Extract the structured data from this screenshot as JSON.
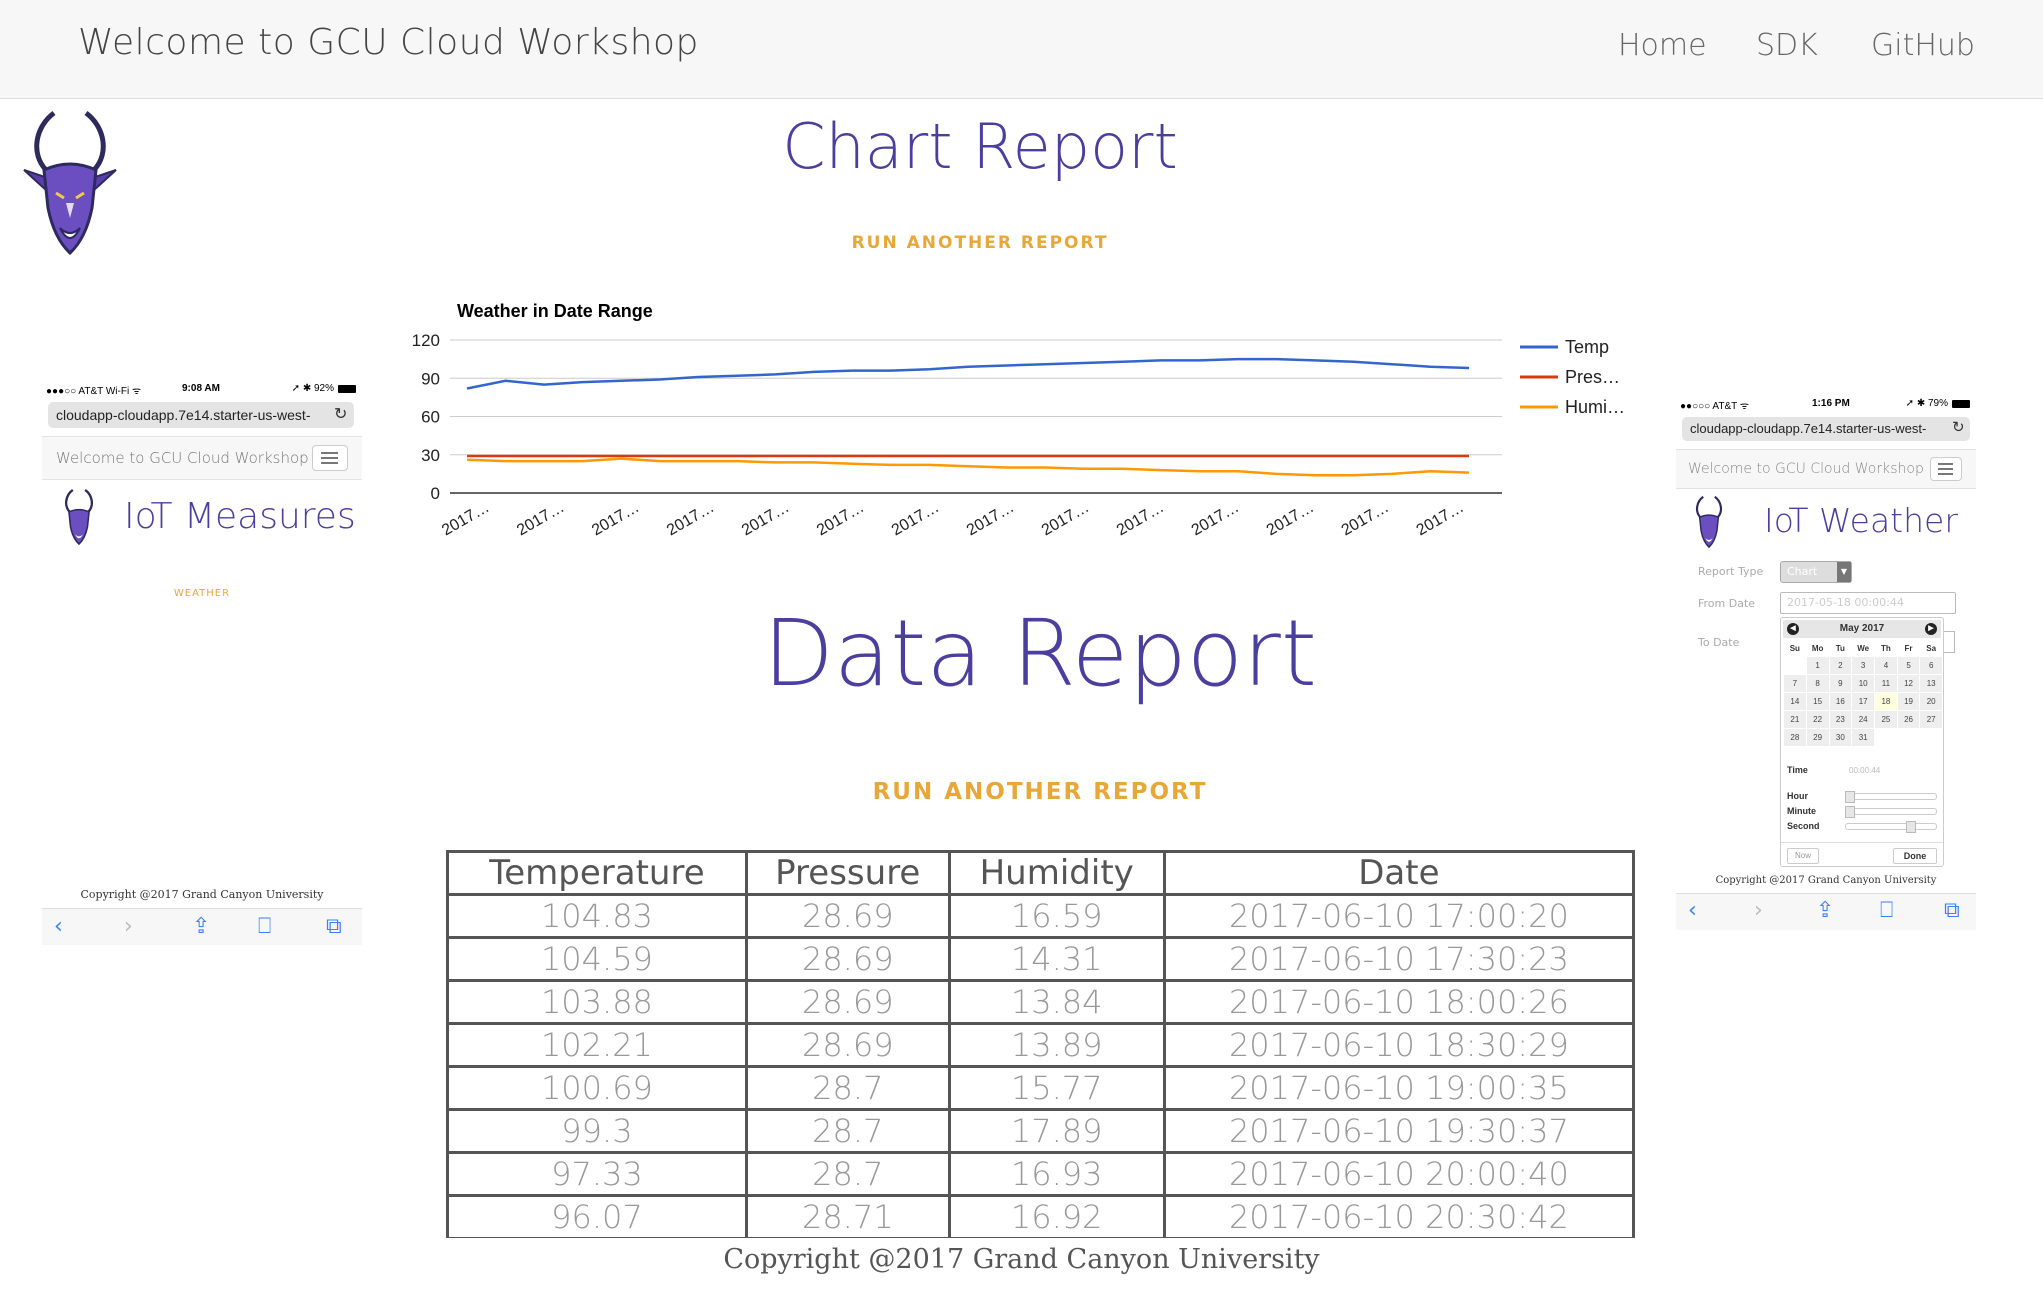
{
  "navbar": {
    "brand": "Welcome to GCU Cloud Workshop",
    "links": [
      "Home",
      "SDK",
      "GitHub"
    ]
  },
  "chart_section": {
    "heading": "Chart Report",
    "run_link": "RUN ANOTHER REPORT"
  },
  "chart_data": {
    "type": "line",
    "title": "Weather in Date Range",
    "xlabel": "",
    "ylabel": "",
    "ylim": [
      0,
      120
    ],
    "y_ticks": [
      0,
      30,
      60,
      90,
      120
    ],
    "x_tick_labels": [
      "2017…",
      "2017…",
      "2017…",
      "2017…",
      "2017…",
      "2017…",
      "2017…",
      "2017…",
      "2017…",
      "2017…",
      "2017…",
      "2017…",
      "2017…",
      "2017…"
    ],
    "legend_position": "right",
    "series": [
      {
        "name": "Temp",
        "color": "#3366cc",
        "values": [
          82,
          88,
          85,
          87,
          88,
          89,
          91,
          92,
          93,
          95,
          96,
          96,
          97,
          99,
          100,
          101,
          102,
          103,
          104,
          104,
          105,
          105,
          104,
          103,
          101,
          99,
          98
        ]
      },
      {
        "name": "Pres…",
        "color": "#dc3912",
        "values": [
          29,
          29,
          29,
          29,
          29,
          29,
          29,
          29,
          29,
          29,
          29,
          29,
          29,
          29,
          29,
          29,
          29,
          29,
          29,
          29,
          29,
          29,
          29,
          29,
          29,
          29,
          29
        ]
      },
      {
        "name": "Humi…",
        "color": "#ff9900",
        "values": [
          26,
          25,
          25,
          25,
          27,
          25,
          25,
          25,
          24,
          24,
          23,
          22,
          22,
          21,
          20,
          20,
          19,
          19,
          18,
          17,
          17,
          15,
          14,
          14,
          15,
          17,
          16
        ]
      }
    ]
  },
  "data_section": {
    "heading": "Data Report",
    "run_link": "RUN ANOTHER REPORT",
    "columns": [
      "Temperature",
      "Pressure",
      "Humidity",
      "Date"
    ],
    "rows": [
      [
        "104.83",
        "28.69",
        "16.59",
        "2017-06-10 17:00:20"
      ],
      [
        "104.59",
        "28.69",
        "14.31",
        "2017-06-10 17:30:23"
      ],
      [
        "103.88",
        "28.69",
        "13.84",
        "2017-06-10 18:00:26"
      ],
      [
        "102.21",
        "28.69",
        "13.89",
        "2017-06-10 18:30:29"
      ],
      [
        "100.69",
        "28.7",
        "15.77",
        "2017-06-10 19:00:35"
      ],
      [
        "99.3",
        "28.7",
        "17.89",
        "2017-06-10 19:30:37"
      ],
      [
        "97.33",
        "28.7",
        "16.93",
        "2017-06-10 20:00:40"
      ],
      [
        "96.07",
        "28.71",
        "16.92",
        "2017-06-10 20:30:42"
      ]
    ]
  },
  "footer": {
    "copyright": "Copyright @2017 Grand Canyon University"
  },
  "phone_left": {
    "status_carrier": "●●●○○ AT&T Wi-Fi ᯤ",
    "status_time": "9:08 AM",
    "status_battery": "➚ ✱ 92%",
    "url": "cloudapp-cloudapp.7e14.starter-us-west-",
    "nav_brand": "Welcome to GCU Cloud Workshop",
    "page_title": "IoT Measures",
    "link": "WEATHER",
    "copyright": "Copyright @2017 Grand Canyon University"
  },
  "phone_right": {
    "status_carrier": "●●○○○ AT&T ᯤ",
    "status_time": "1:16 PM",
    "status_battery": "➚ ✱ 79%",
    "url": "cloudapp-cloudapp.7e14.starter-us-west-",
    "nav_brand": "Welcome to GCU Cloud Workshop",
    "page_title": "IoT Weather",
    "report_type_label": "Report Type",
    "report_type_value": "Chart",
    "from_date_label": "From Date",
    "from_date_value": "2017-05-18 00:00:44",
    "to_date_label": "To Date",
    "calendar": {
      "month": "May 2017",
      "days_header": [
        "Su",
        "Mo",
        "Tu",
        "We",
        "Th",
        "Fr",
        "Sa"
      ],
      "weeks": [
        [
          "",
          "1",
          "2",
          "3",
          "4",
          "5",
          "6"
        ],
        [
          "7",
          "8",
          "9",
          "10",
          "11",
          "12",
          "13"
        ],
        [
          "14",
          "15",
          "16",
          "17",
          "18",
          "19",
          "20"
        ],
        [
          "21",
          "22",
          "23",
          "24",
          "25",
          "26",
          "27"
        ],
        [
          "28",
          "29",
          "30",
          "31",
          "",
          "",
          ""
        ]
      ],
      "today": "18",
      "time_label": "Time",
      "time_value": "00:00:44",
      "hour_label": "Hour",
      "minute_label": "Minute",
      "second_label": "Second",
      "now_button": "Now",
      "done_button": "Done"
    },
    "copyright": "Copyright @2017 Grand Canyon University"
  }
}
